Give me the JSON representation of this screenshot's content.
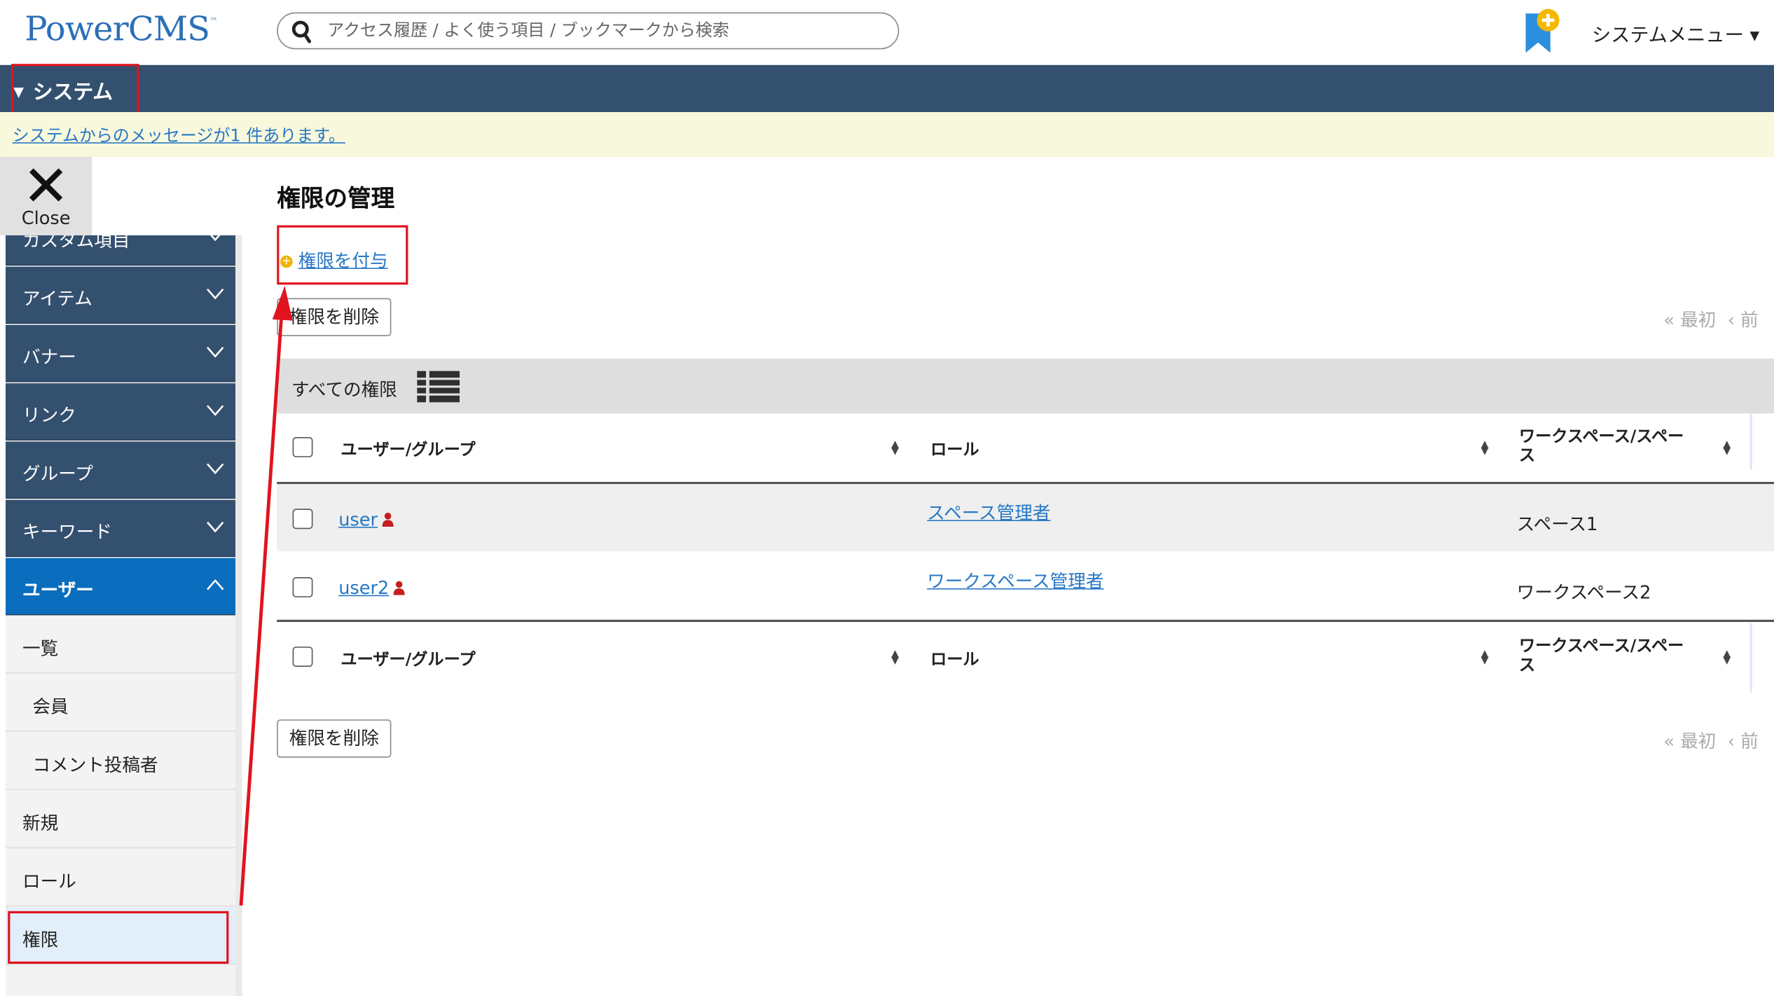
{
  "header": {
    "logo": "PowerCMS",
    "logo_tm": "™",
    "search_placeholder": "アクセス履歴 / よく使う項目 / ブックマークから検索",
    "system_menu": "システムメニュー"
  },
  "system_bar": {
    "label": "システム",
    "toggle_glyph": "▼"
  },
  "message_bar": {
    "text": "システムからのメッセージが1 件あります。"
  },
  "sidebar": {
    "close_label": "Close",
    "groups": [
      {
        "label": "カスタム項目"
      },
      {
        "label": "アイテム"
      },
      {
        "label": "バナー"
      },
      {
        "label": "リンク"
      },
      {
        "label": "グループ"
      },
      {
        "label": "キーワード"
      },
      {
        "label": "ユーザー"
      }
    ],
    "user_items": [
      {
        "label": "一覧"
      },
      {
        "label": "会員"
      },
      {
        "label": "コメント投稿者"
      },
      {
        "label": "新規"
      },
      {
        "label": "ロール"
      },
      {
        "label": "権限"
      }
    ]
  },
  "main": {
    "title": "権限の管理",
    "add_link": "権限を付与",
    "delete_button": "権限を削除",
    "pager_first": "« 最初",
    "pager_prev": "‹ 前",
    "list_title": "すべての権限",
    "columns": [
      "ユーザー/グループ",
      "ロール",
      "ワークスペース/スペース"
    ],
    "rows": [
      {
        "user": "user",
        "role": "スペース管理者",
        "space": "スペース1"
      },
      {
        "user": "user2",
        "role": "ワークスペース管理者",
        "space": "ワークスペース2"
      }
    ]
  },
  "colors": {
    "brand_blue": "#2b6fb6",
    "nav_bg": "#34506f",
    "nav_active": "#0a6dbd",
    "link": "#2778c6",
    "message_bg": "#f8f8dc",
    "annotation_red": "#e0141e"
  },
  "icons": [
    "search-icon",
    "bookmark-add-icon",
    "chevron-down-icon",
    "close-icon",
    "list-view-icon",
    "sort-icon",
    "user-icon",
    "plus-icon"
  ]
}
